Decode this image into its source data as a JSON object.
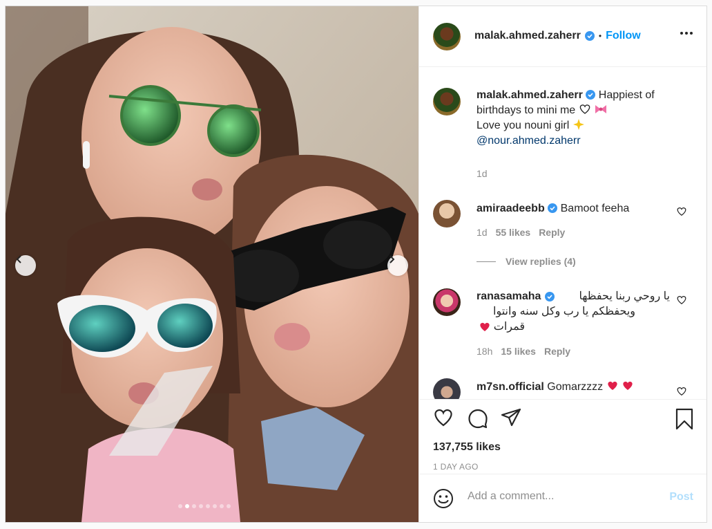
{
  "post": {
    "username": "malak.ahmed.zaherr",
    "follow_label": "Follow",
    "bullet": "•",
    "caption_line1": "Happiest of",
    "caption_line2": "birthdays to mini me",
    "caption_line3": "Love you nouni girl",
    "caption_mention": "@nour.ahmed.zaherr",
    "caption_time": "1d",
    "likes": "137,755 likes",
    "time_ago": "1 DAY AGO",
    "photo_count": 8,
    "active_photo": 2
  },
  "comments": [
    {
      "username": "amiraadeebb",
      "text": "Bamoot feeha",
      "time": "1d",
      "likes": "55 likes",
      "reply": "Reply",
      "view_replies": "View replies (4)"
    },
    {
      "username": "ranasamaha",
      "text_line1": "يا روحي ربنا يحفظها",
      "text_line2": "ويحفظكم يا رب وكل سنه وانتوا",
      "text_line3": "قمرات",
      "time": "18h",
      "likes": "15 likes",
      "reply": "Reply"
    },
    {
      "username": "m7sn.official",
      "text": "Gomarzzzz"
    }
  ],
  "add_comment": {
    "placeholder": "Add a comment...",
    "post_label": "Post"
  },
  "colors": {
    "accent": "#0095f6",
    "verified": "#3897f0",
    "muted": "#8e8e8e",
    "heart_red": "#ed4956"
  },
  "icons": [
    "heart-icon",
    "comment-icon",
    "share-icon",
    "bookmark-icon",
    "emoji-icon",
    "more-icon",
    "verified-icon",
    "chevron-left-icon",
    "chevron-right-icon"
  ]
}
